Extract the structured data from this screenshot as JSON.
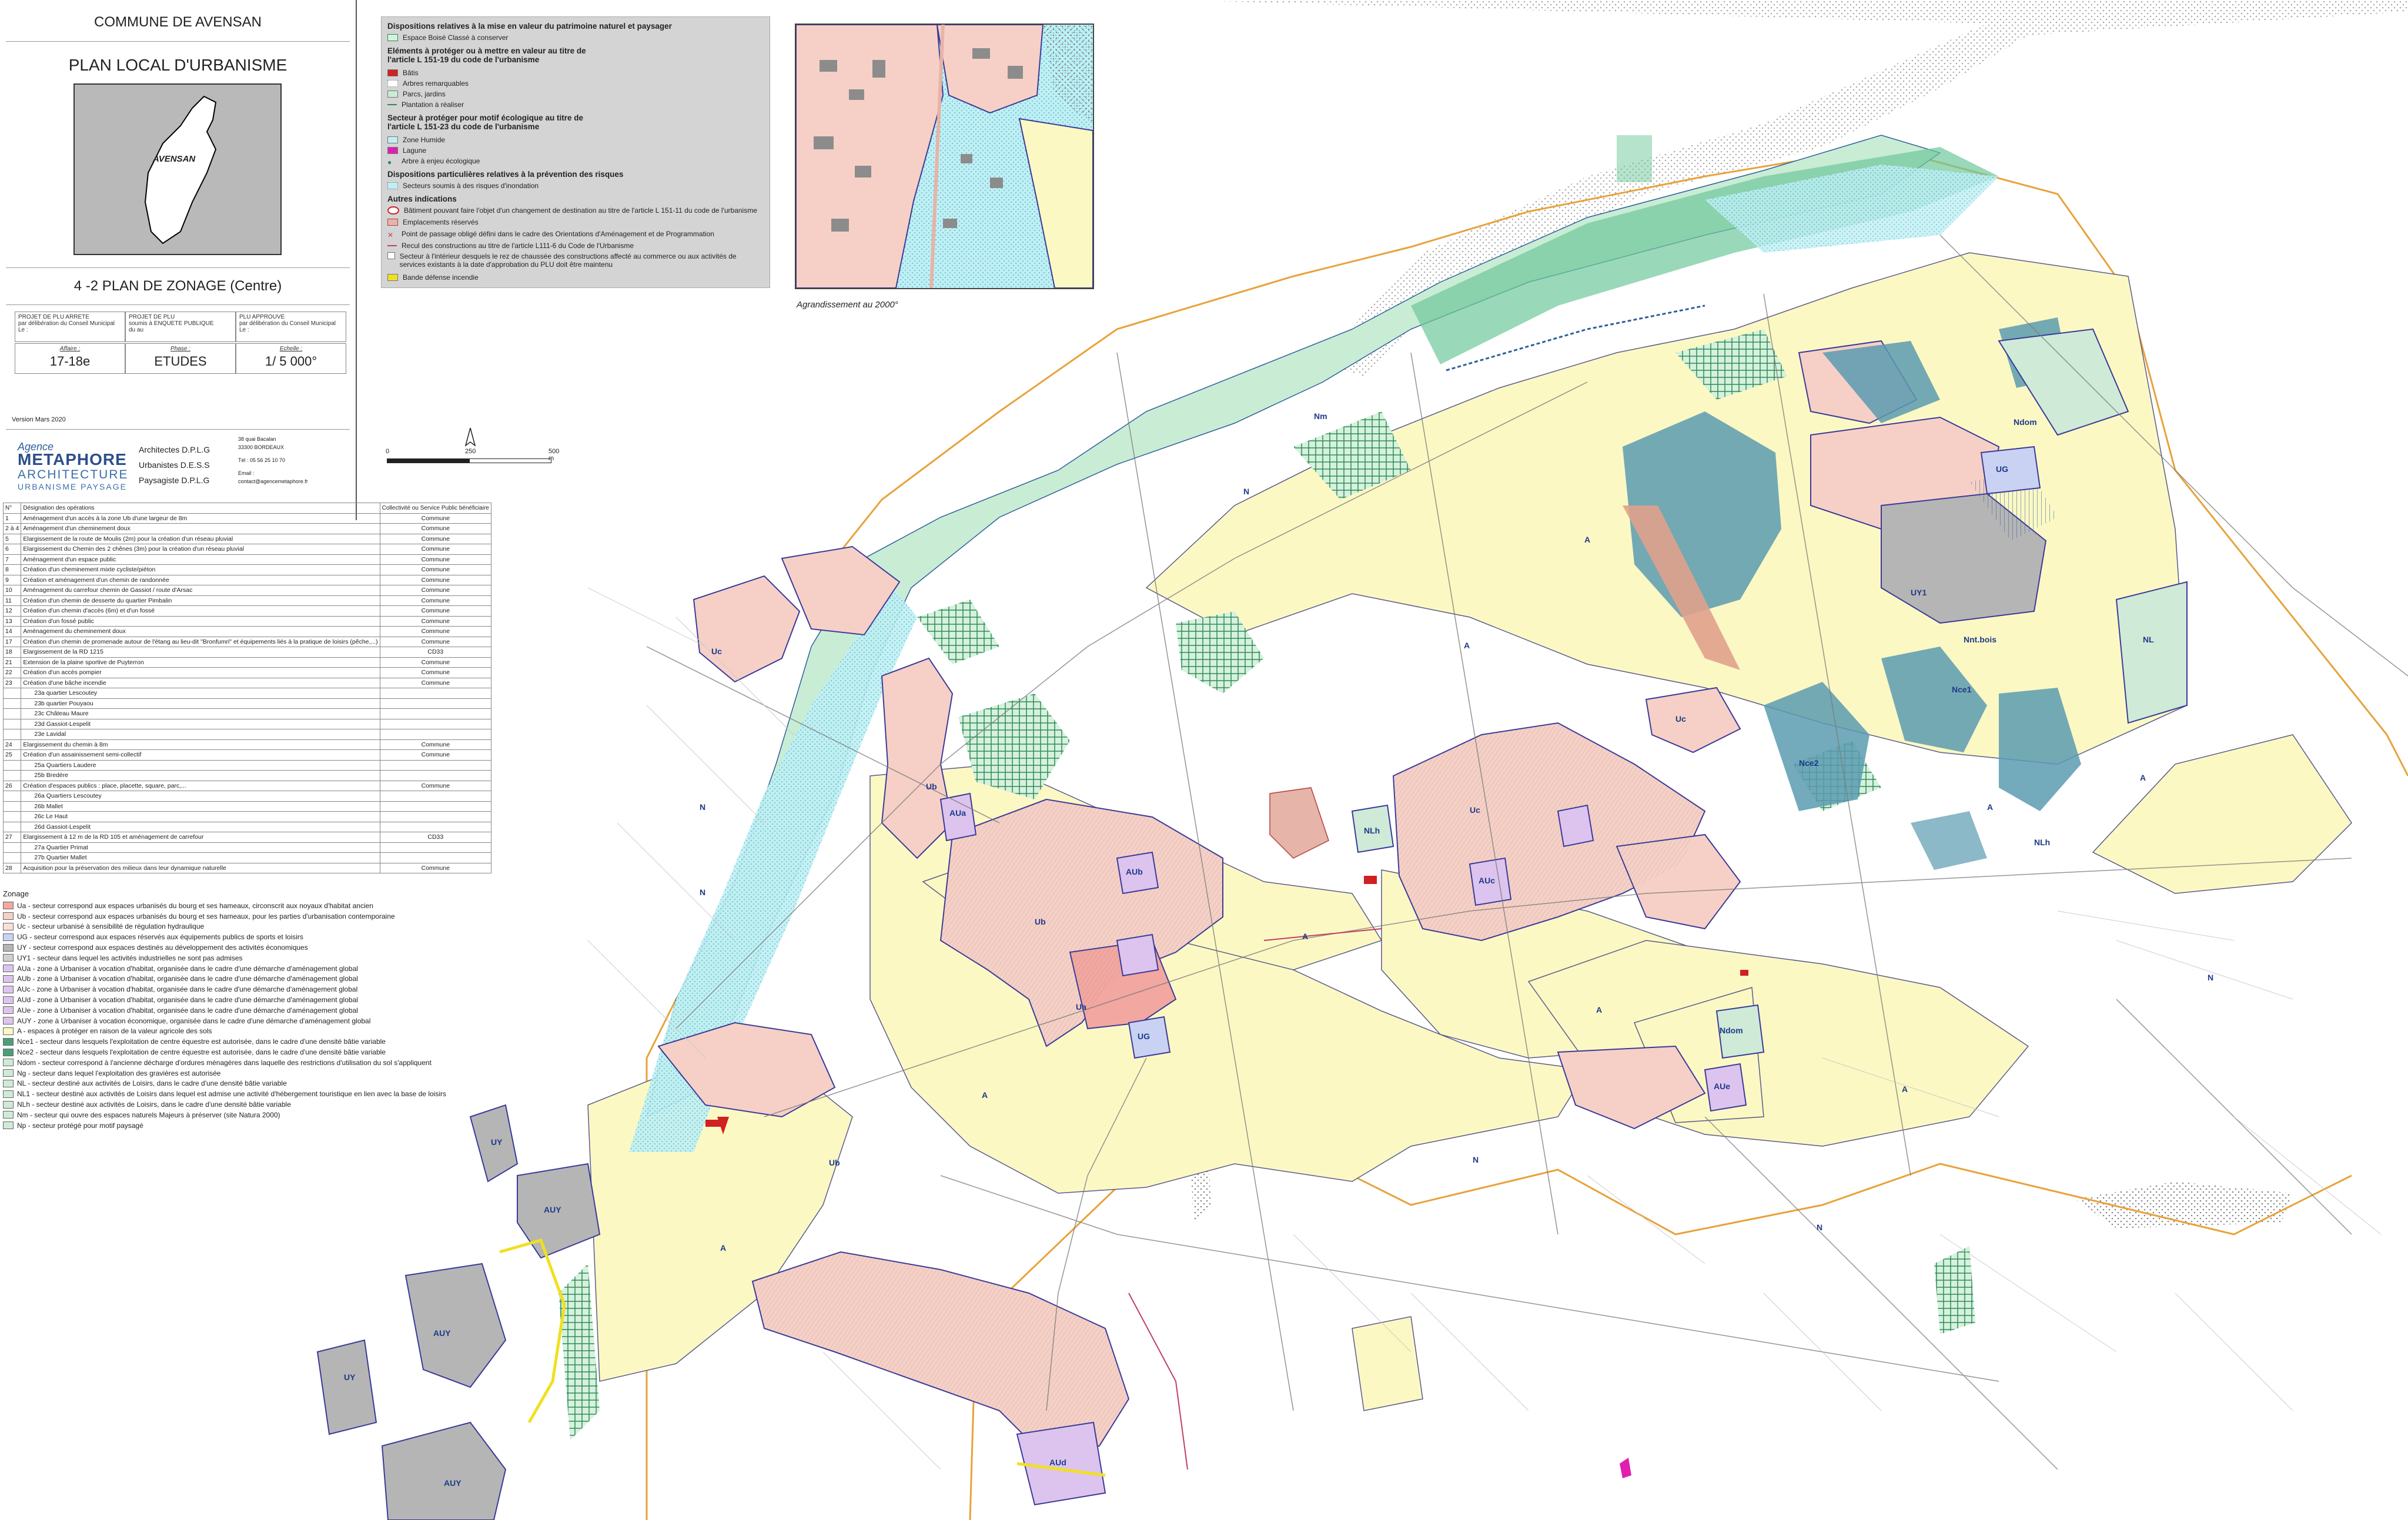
{
  "cartouche": {
    "commune": "COMMUNE DE AVENSAN",
    "plan_title": "PLAN LOCAL D'URBANISME",
    "locator_label": "AVENSAN",
    "plan_subtitle": "4 -2 PLAN DE ZONAGE (Centre)",
    "boxes": [
      {
        "label": "PROJET DE PLU ARRETE",
        "line1": "par délibération du Conseil Municipal",
        "line2": "Le :"
      },
      {
        "label": "PROJET DE PLU",
        "line1": "soumis à ENQUETE PUBLIQUE",
        "line2": "du                    au"
      },
      {
        "label": "PLU APPROUVE",
        "line1": "par délibération du Conseil Municipal",
        "line2": "Le :"
      }
    ],
    "affaire_label": "Affaire :",
    "affaire_value": "17-18e",
    "phase_label": "Phase :",
    "phase_value": "ETUDES",
    "echelle_label": "Echelle :",
    "echelle_value": "1/ 5 000°",
    "version": "Version Mars 2020",
    "agency_small": "Agence",
    "agency_name": "METAPHORE",
    "agency_line2": "ARCHITECTURE",
    "agency_line3": "URBANISME PAYSAGE",
    "roles": [
      "Architectes D.P.L.G",
      "Urbanistes D.E.S.S",
      "Paysagiste D.P.L.G"
    ],
    "address": [
      "38 quai Bacalan",
      "33300 BORDEAUX",
      "Tél : 05 56 25 10 70",
      "Email :",
      "contact@agencemetaphore.fr"
    ]
  },
  "operations": {
    "headers": [
      "N°",
      "Désignation des opérations",
      "Collectivité ou Service Public bénéficiaire"
    ],
    "rows": [
      [
        "1",
        "Aménagement d'un accès à la zone Ub d'une largeur de 8m",
        "Commune"
      ],
      [
        "2 à 4",
        "Aménagement d'un cheminement doux",
        "Commune"
      ],
      [
        "5",
        "Elargissement de la route de Moulis (2m) pour la création d'un réseau pluvial",
        "Commune"
      ],
      [
        "6",
        "Elargissement du Chemin des 2 chênes (3m) pour la création d'un réseau pluvial",
        "Commune"
      ],
      [
        "7",
        "Aménagement d'un espace public",
        "Commune"
      ],
      [
        "8",
        "Création d'un cheminement mixte cycliste/piéton",
        "Commune"
      ],
      [
        "9",
        "Création et aménagement d'un chemin de randonnée",
        "Commune"
      ],
      [
        "10",
        "Aménagement du carrefour chemin de Gassiot / route d'Arsac",
        "Commune"
      ],
      [
        "11",
        "Création d'un chemin de desserte du quartier Pimbalin",
        "Commune"
      ],
      [
        "12",
        "Création d'un chemin d'accès (6m) et d'un fossé",
        "Commune"
      ],
      [
        "13",
        "Création d'un fossé public",
        "Commune"
      ],
      [
        "14",
        "Aménagement du cheminement doux",
        "Commune"
      ],
      [
        "17",
        "Création d'un chemin de promenade autour de l'étang au lieu-dit \"Bronfumri\" et équipements liés à la pratique de loisirs (pêche,...)",
        "Commune"
      ],
      [
        "18",
        "Elargissement de la RD 1215",
        "CD33"
      ],
      [
        "21",
        "Extension de la plaine sportive de Puyterron",
        "Commune"
      ],
      [
        "22",
        "Création d'un accès pompier",
        "Commune"
      ],
      [
        "23",
        "Création d'une bâche incendie",
        "Commune"
      ],
      [
        "",
        "23a quartier Lescoutey",
        ""
      ],
      [
        "",
        "23b quartier Pouyaou",
        ""
      ],
      [
        "",
        "23c Château Maure",
        ""
      ],
      [
        "",
        "23d Gassiot-Lespelit",
        ""
      ],
      [
        "",
        "23e Lavidal",
        ""
      ],
      [
        "24",
        "Elargissement du chemin à 8m",
        "Commune"
      ],
      [
        "25",
        "Création d'un assainissement semi-collectif",
        "Commune"
      ],
      [
        "",
        "25a Quartiers Laudere",
        ""
      ],
      [
        "",
        "25b Bredère",
        ""
      ],
      [
        "26",
        "Création d'espaces publics : place, placette, square, parc,...",
        "Commune"
      ],
      [
        "",
        "26a Quartiers Lescoutey",
        ""
      ],
      [
        "",
        "26b Mallet",
        ""
      ],
      [
        "",
        "26c Le Haut",
        ""
      ],
      [
        "",
        "26d Gassiot-Lespelit",
        ""
      ],
      [
        "27",
        "Elargissement à 12 m de la RD 105 et aménagement de carrefour",
        "CD33"
      ],
      [
        "",
        "27a Quartier Primat",
        ""
      ],
      [
        "",
        "27b Quartier Mallet",
        ""
      ],
      [
        "28",
        "Acquisition pour la préservation des milieux dans leur dynamique naturelle",
        "Commune"
      ]
    ]
  },
  "zoning": {
    "title": "Zonage",
    "items": [
      {
        "color": "#f2a7a0",
        "text": "Ua - secteur correspond aux espaces urbanisés du bourg et ses hameaux, circonscrit aux noyaux d'habitat ancien"
      },
      {
        "color": "#f6d0c6",
        "text": "Ub - secteur correspond aux espaces urbanisés du bourg et ses hameaux, pour les parties d'urbanisation contemporaine"
      },
      {
        "color": "#f9e0d6",
        "text": "Uc - secteur urbanisé à sensibilité de régulation hydraulique"
      },
      {
        "color": "#c9d2f2",
        "text": "UG - secteur correspond aux espaces réservés aux équipements publics de sports et loisirs"
      },
      {
        "color": "#b5b5b5",
        "text": "UY - secteur correspond aux espaces destinés au développement des activités économiques"
      },
      {
        "color": "#d0d0d0",
        "text": "UY1 - secteur dans lequel les activités industrielles ne sont pas admises"
      },
      {
        "color": "#dcc4ee",
        "text": "AUa - zone à Urbaniser à vocation d'habitat, organisée dans le cadre d'une démarche d'aménagement global"
      },
      {
        "color": "#dcc4ee",
        "text": "AUb - zone à Urbaniser à vocation d'habitat, organisée dans le cadre d'une démarche d'aménagement global"
      },
      {
        "color": "#dcc4ee",
        "text": "AUc - zone à Urbaniser à vocation d'habitat, organisée dans le cadre d'une démarche d'aménagement global"
      },
      {
        "color": "#dcc4ee",
        "text": "AUd - zone à Urbaniser à vocation d'habitat, organisée dans le cadre d'une démarche d'aménagement global"
      },
      {
        "color": "#dcc4ee",
        "text": "AUe - zone à Urbaniser à vocation d'habitat, organisée dans le cadre d'une démarche d'aménagement global"
      },
      {
        "color": "#dcc4ee",
        "text": "AUY - zone à Urbaniser à vocation économique, organisée dans le cadre d'une démarche d'aménagement global"
      },
      {
        "color": "#fbf8c4",
        "text": "A - espaces à protéger en raison de la valeur agricole des sols"
      },
      {
        "color": "#4d9e78",
        "text": "Nce1 - secteur dans lesquels l'exploitation de centre équestre est autorisée, dans le cadre d'une densité bâtie variable"
      },
      {
        "color": "#4d9e78",
        "text": "Nce2 - secteur dans lesquels l'exploitation de centre équestre est autorisée, dans le cadre d'une densité bâtie variable"
      },
      {
        "color": "#cfead7",
        "text": "Ndom - secteur correspond à l'ancienne décharge d'ordures ménagères dans laquelle des restrictions d'utilisation du sol s'appliquent"
      },
      {
        "color": "#cfead7",
        "text": "Ng - secteur dans lequel l'exploitation des gravières est autorisée"
      },
      {
        "color": "#cfead7",
        "text": "NL - secteur destiné aux activités de Loisirs, dans le cadre d'une densité bâtie variable"
      },
      {
        "color": "#cfead7",
        "text": "NL1 - secteur destiné aux activités de Loisirs dans lequel est admise une activité d'hébergement touristique en lien avec la base de loisirs"
      },
      {
        "color": "#cfead7",
        "text": "NLh - secteur destiné aux activités de Loisirs, dans le cadre d'une densité bâtie variable"
      },
      {
        "color": "#cfead7",
        "text": "Nm - secteur qui ouvre des espaces naturels Majeurs à préserver (site Natura 2000)"
      },
      {
        "color": "#cfead7",
        "text": "Np - secteur protégé pour motif paysagé"
      }
    ]
  },
  "legend": {
    "s1_title": "Dispositions relatives à la mise en valeur du patrimoine naturel et paysager",
    "s1_items": [
      "Espace Boisé Classé à conserver"
    ],
    "s2_title": "Eléments à protéger ou à mettre en valeur au titre de l'article L 151-19 du code de l'urbanisme",
    "s2_items": [
      "Bâtis",
      "Arbres remarquables",
      "Parcs, jardins",
      "Plantation à réaliser"
    ],
    "s3_title": "Secteur à protéger pour motif écologique au titre de l'article L 151-23 du code de l'urbanisme",
    "s3_items": [
      "Zone Humide",
      "Lagune",
      "Arbre à enjeu écologique"
    ],
    "s4_title": "Dispositions particulières relatives à la prévention des risques",
    "s4_items": [
      "Secteurs soumis à des risques d'inondation"
    ],
    "s5_title": "Autres indications",
    "s5_items": [
      "Bâtiment pouvant faire l'objet d'un changement de destination au titre de l'article L 151-11 du code de l'urbanisme",
      "Emplacements réservés",
      "Point de passage obligé défini dans le cadre des Orientations d'Aménagement et de Programmation",
      "Recul des constructions au titre de l'article L111-6 du Code de l'Urbanisme",
      "Secteur à l'intérieur desquels le rez de chaussée des constructions affecté au commerce ou aux activités de services existants à la date d'approbation du PLU doit être maintenu",
      "Bande défense incendie"
    ]
  },
  "inset": {
    "caption": "Agrandissement au 2000°"
  },
  "scale": {
    "labels": [
      "0",
      "250",
      "500 m"
    ],
    "north": "N"
  },
  "map_labels": [
    "N",
    "N",
    "N",
    "N",
    "N",
    "N",
    "A",
    "A",
    "A",
    "A",
    "A",
    "A",
    "A",
    "A",
    "A",
    "Ua",
    "Ub",
    "Ub",
    "Ub",
    "Uc",
    "Uc",
    "Uc",
    "UG",
    "UG",
    "UY",
    "UY",
    "UY1",
    "AUY",
    "AUY",
    "AUY",
    "AUd",
    "AUa",
    "AUb",
    "AUc",
    "AUe",
    "NL",
    "NLh",
    "NLh",
    "Ndom",
    "Ndom",
    "Nm",
    "Nce1",
    "Nce2",
    "Nnt.bois"
  ],
  "colors": {
    "agri": "#fbf8c4",
    "urban_a": "#f2a7a0",
    "urban_b": "#f6d0c6",
    "natural_green": "#8fd6a8",
    "wetland": "#5a9bb0",
    "flood": "#bfeff4",
    "activity": "#b5b5b5",
    "au": "#dcc4ee",
    "boundary": "#e8a23a"
  }
}
